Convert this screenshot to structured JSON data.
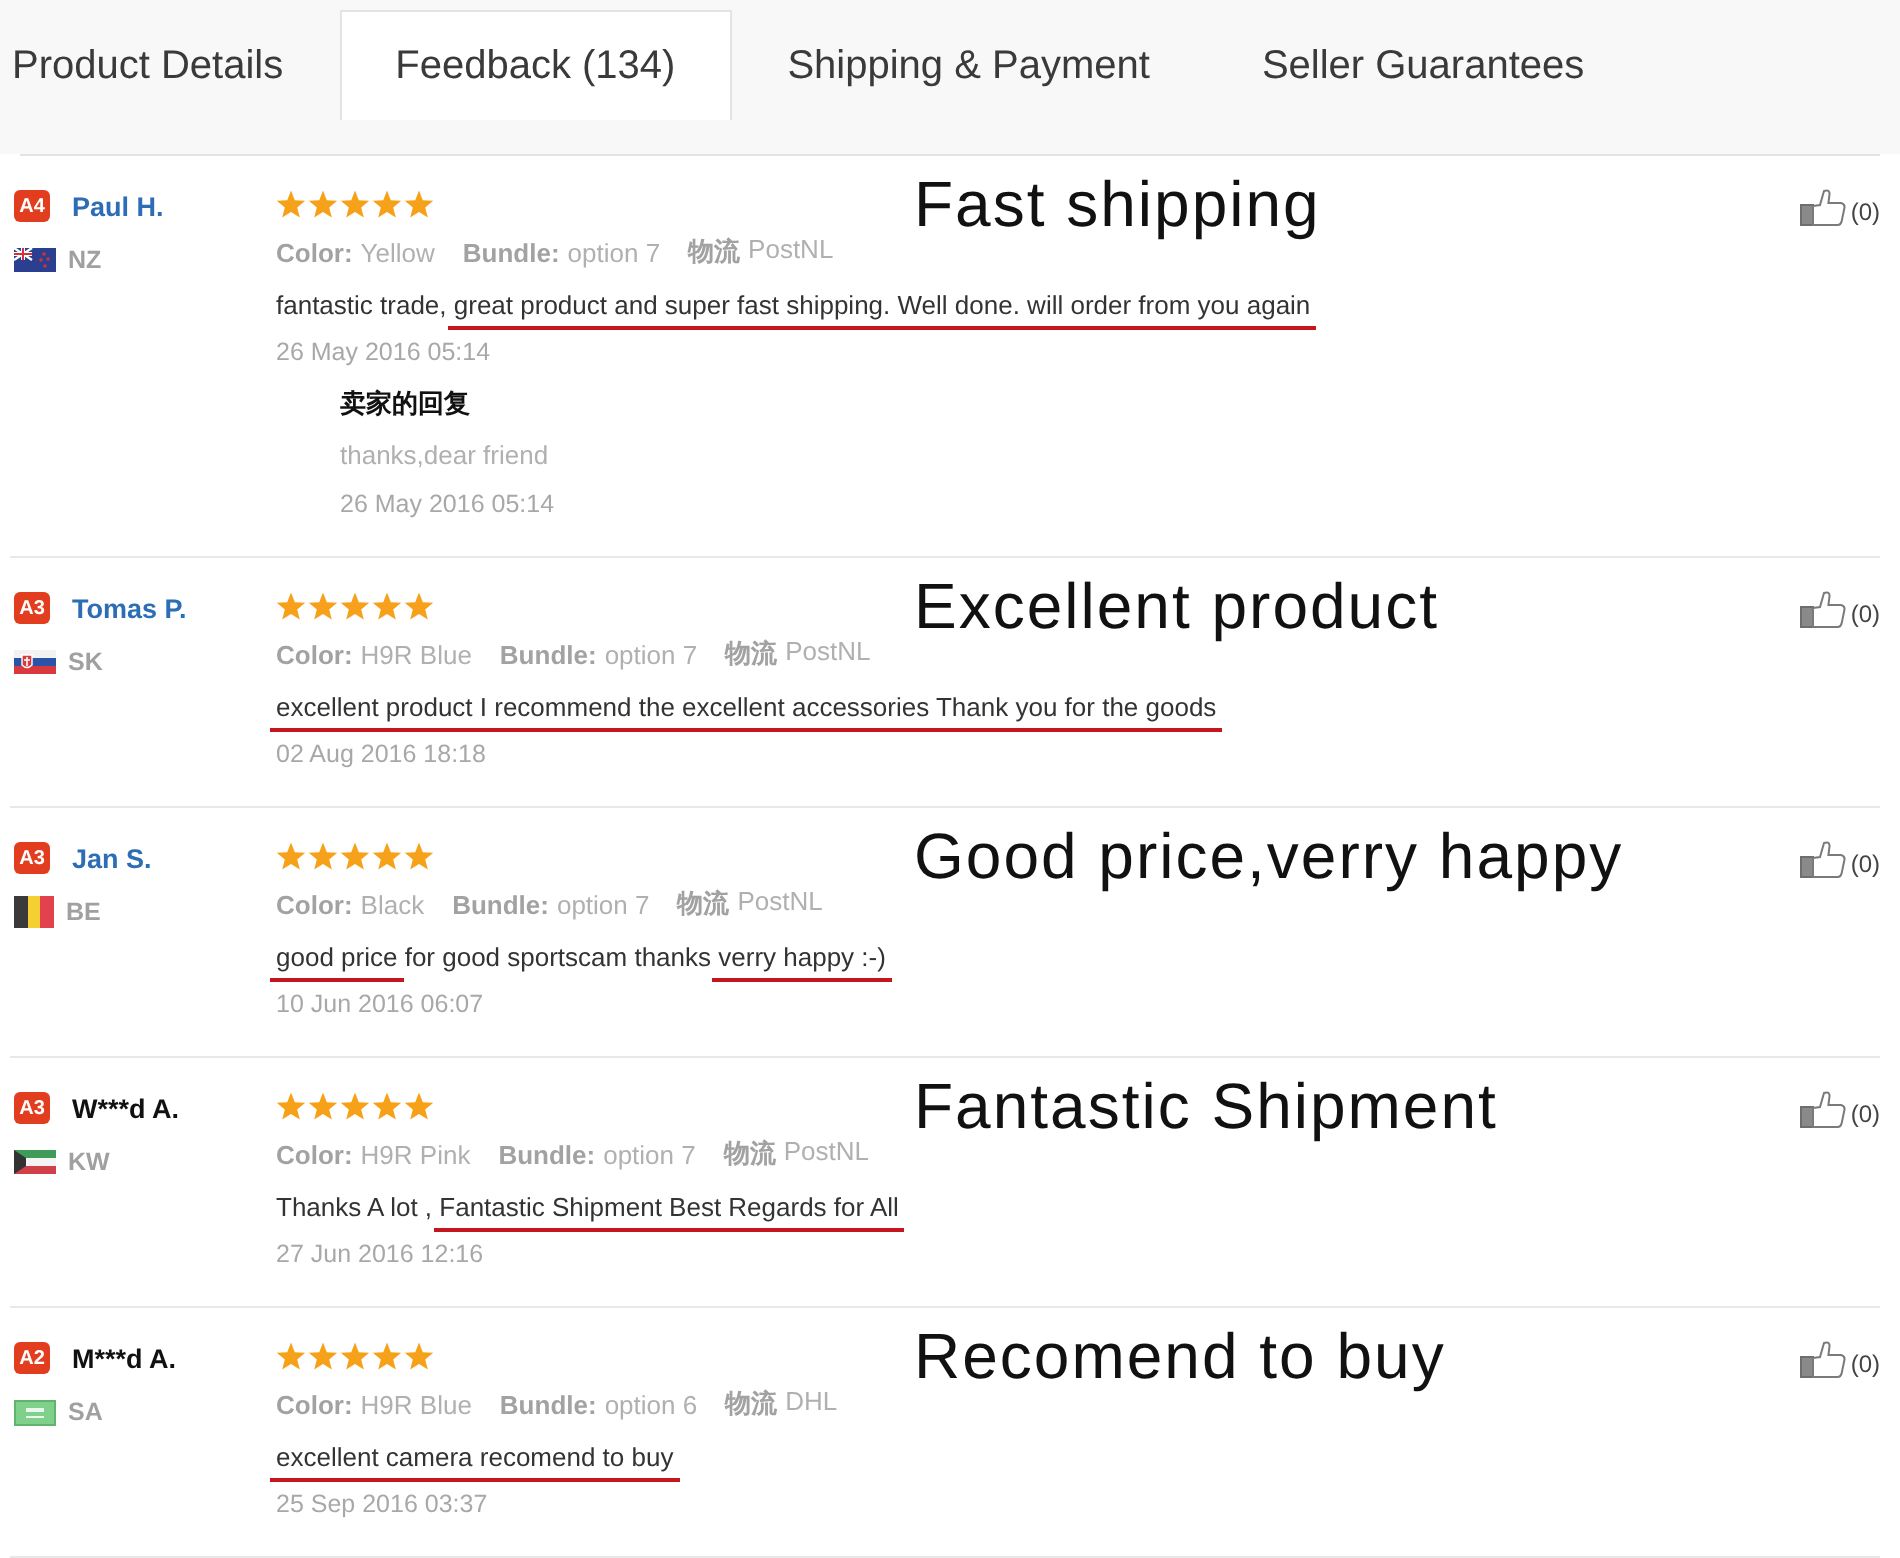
{
  "tabs": [
    {
      "label": "Product Details",
      "selected": false
    },
    {
      "label": "Feedback (134)",
      "selected": true
    },
    {
      "label": "Shipping & Payment",
      "selected": false
    },
    {
      "label": "Seller Guarantees",
      "selected": false
    }
  ],
  "reviews": [
    {
      "reviewer": {
        "badge": "A4",
        "name": "Paul H.",
        "color": "#2d6db5",
        "flag": {
          "kind": "nz"
        },
        "country": "NZ"
      },
      "stars": 5,
      "headline": "Fast shipping",
      "attributes": [
        {
          "label": "Color:",
          "value": "Yellow"
        },
        {
          "label": "Bundle:",
          "value": "option 7"
        },
        {
          "label": "物流",
          "value": "PostNL"
        }
      ],
      "comment": [
        {
          "text": "fantastic trade, ",
          "underlined": false
        },
        {
          "text": "great product and super fast shipping. Well done. will order from you again",
          "underlined": true
        }
      ],
      "date": "26 May 2016 05:14",
      "seller_reply": {
        "title": "卖家的回复",
        "text": "thanks,dear friend",
        "date": "26 May 2016 05:14"
      },
      "likes": "(0)"
    },
    {
      "reviewer": {
        "badge": "A3",
        "name": "Tomas P.",
        "color": "#2d6db5",
        "flag": {
          "kind": "sk"
        },
        "country": "SK"
      },
      "stars": 5,
      "headline": "Excellent product",
      "attributes": [
        {
          "label": "Color:",
          "value": "H9R Blue"
        },
        {
          "label": "Bundle:",
          "value": "option 7"
        },
        {
          "label": "物流",
          "value": "PostNL"
        }
      ],
      "comment": [
        {
          "text": "excellent product I recommend the excellent accessories Thank you for the goods",
          "underlined": true
        }
      ],
      "date": "02 Aug 2016 18:18",
      "likes": "(0)"
    },
    {
      "reviewer": {
        "badge": "A3",
        "name": "Jan S.",
        "color": "#2d6db5",
        "flag": {
          "kind": "be"
        },
        "country": "BE"
      },
      "stars": 5,
      "headline": "Good price,verry happy",
      "attributes": [
        {
          "label": "Color:",
          "value": "Black"
        },
        {
          "label": "Bundle:",
          "value": "option 7"
        },
        {
          "label": "物流",
          "value": "PostNL"
        }
      ],
      "comment": [
        {
          "text": "good price",
          "underlined": true
        },
        {
          "text": " for good sportscam thanks ",
          "underlined": false
        },
        {
          "text": "verry happy :-)",
          "underlined": true
        }
      ],
      "date": "10 Jun 2016 06:07",
      "likes": "(0)"
    },
    {
      "reviewer": {
        "badge": "A3",
        "name": "W***d A.",
        "color": "#111111",
        "flag": {
          "kind": "kw"
        },
        "country": "KW"
      },
      "stars": 5,
      "headline": "Fantastic Shipment",
      "attributes": [
        {
          "label": "Color:",
          "value": "H9R Pink"
        },
        {
          "label": "Bundle:",
          "value": "option 7"
        },
        {
          "label": "物流",
          "value": "PostNL"
        }
      ],
      "comment": [
        {
          "text": "Thanks A lot , ",
          "underlined": false
        },
        {
          "text": "Fantastic Shipment Best Regards for All",
          "underlined": true
        }
      ],
      "date": "27 Jun 2016 12:16",
      "likes": "(0)"
    },
    {
      "reviewer": {
        "badge": "A2",
        "name": "M***d A.",
        "color": "#111111",
        "flag": {
          "kind": "sa"
        },
        "country": "SA"
      },
      "stars": 5,
      "headline": "Recomend to buy",
      "attributes": [
        {
          "label": "Color:",
          "value": "H9R Blue"
        },
        {
          "label": "Bundle:",
          "value": "option 6"
        },
        {
          "label": "物流",
          "value": "DHL"
        }
      ],
      "comment": [
        {
          "text": "excellent camera recomend to buy",
          "underlined": true
        }
      ],
      "date": "25 Sep 2016 03:37",
      "likes": "(0)"
    }
  ]
}
